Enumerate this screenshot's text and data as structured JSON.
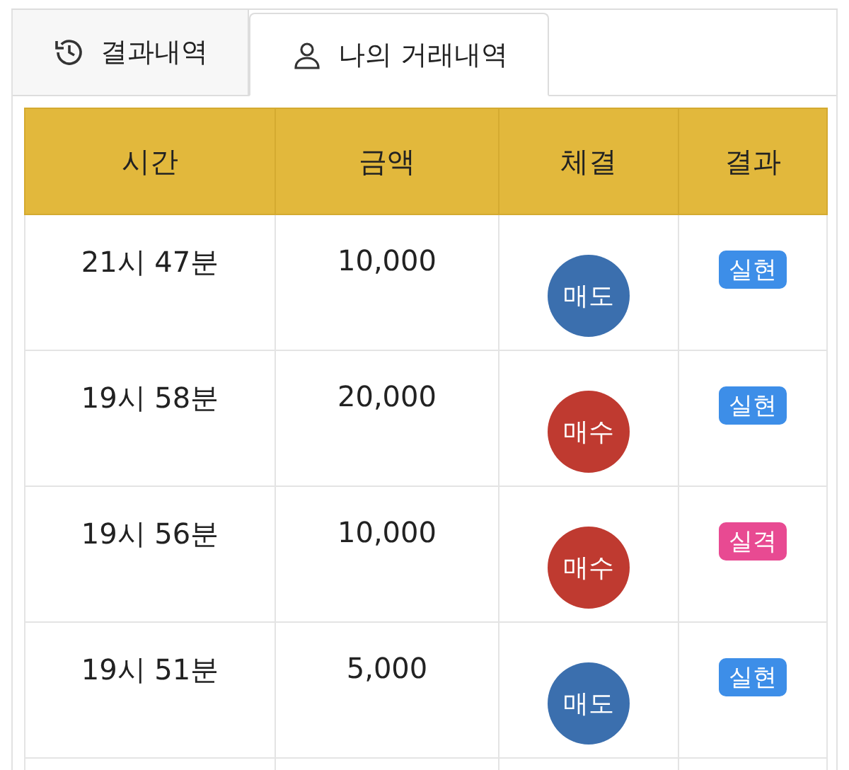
{
  "tabs": [
    {
      "label": "결과내역",
      "selected": false
    },
    {
      "label": "나의 거래내역",
      "selected": true
    }
  ],
  "table": {
    "columns": [
      "시간",
      "금액",
      "체결",
      "결과"
    ],
    "rows": [
      {
        "time": "21시 47분",
        "amount": "10,000",
        "trade": {
          "label": "매도",
          "color": "#3b6fae"
        },
        "result": {
          "label": "실현",
          "color": "#3d8ee8"
        }
      },
      {
        "time": "19시 58분",
        "amount": "20,000",
        "trade": {
          "label": "매수",
          "color": "#bf3a30"
        },
        "result": {
          "label": "실현",
          "color": "#3d8ee8"
        }
      },
      {
        "time": "19시 56분",
        "amount": "10,000",
        "trade": {
          "label": "매수",
          "color": "#bf3a30"
        },
        "result": {
          "label": "실격",
          "color": "#e84a92"
        }
      },
      {
        "time": "19시 51분",
        "amount": "5,000",
        "trade": {
          "label": "매도",
          "color": "#3b6fae"
        },
        "result": {
          "label": "실현",
          "color": "#3d8ee8"
        }
      }
    ]
  }
}
